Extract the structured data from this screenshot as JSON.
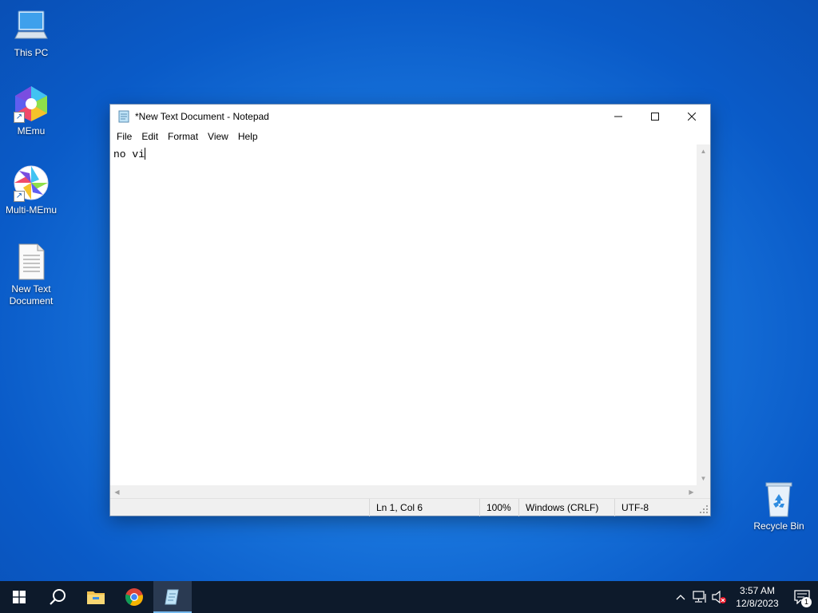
{
  "desktop": {
    "icons": [
      {
        "label": "This PC",
        "icon": "computer-icon"
      },
      {
        "label": "MEmu",
        "icon": "memu-icon"
      },
      {
        "label": "Multi-MEmu",
        "icon": "multi-memu-icon"
      },
      {
        "label": "New Text Document",
        "icon": "text-file-icon"
      },
      {
        "label": "Recycle Bin",
        "icon": "recycle-bin-icon"
      }
    ]
  },
  "window": {
    "title": "*New Text Document - Notepad",
    "controls": {
      "minimize": "minimize-icon",
      "maximize": "maximize-icon",
      "close": "close-icon"
    },
    "menu": [
      "File",
      "Edit",
      "Format",
      "View",
      "Help"
    ],
    "content": "no vi",
    "status": {
      "position": "Ln 1, Col 6",
      "zoom": "100%",
      "line_endings": "Windows (CRLF)",
      "encoding": "UTF-8"
    }
  },
  "taskbar": {
    "apps": [
      "start-icon",
      "search-icon",
      "file-explorer-icon",
      "chrome-icon",
      "notepad-icon"
    ],
    "tray": {
      "time": "3:57 AM",
      "date": "12/8/2023",
      "notification_count": "1"
    }
  },
  "colors": {
    "accent": "#0078d7",
    "taskbar": "#0d1a2b"
  }
}
